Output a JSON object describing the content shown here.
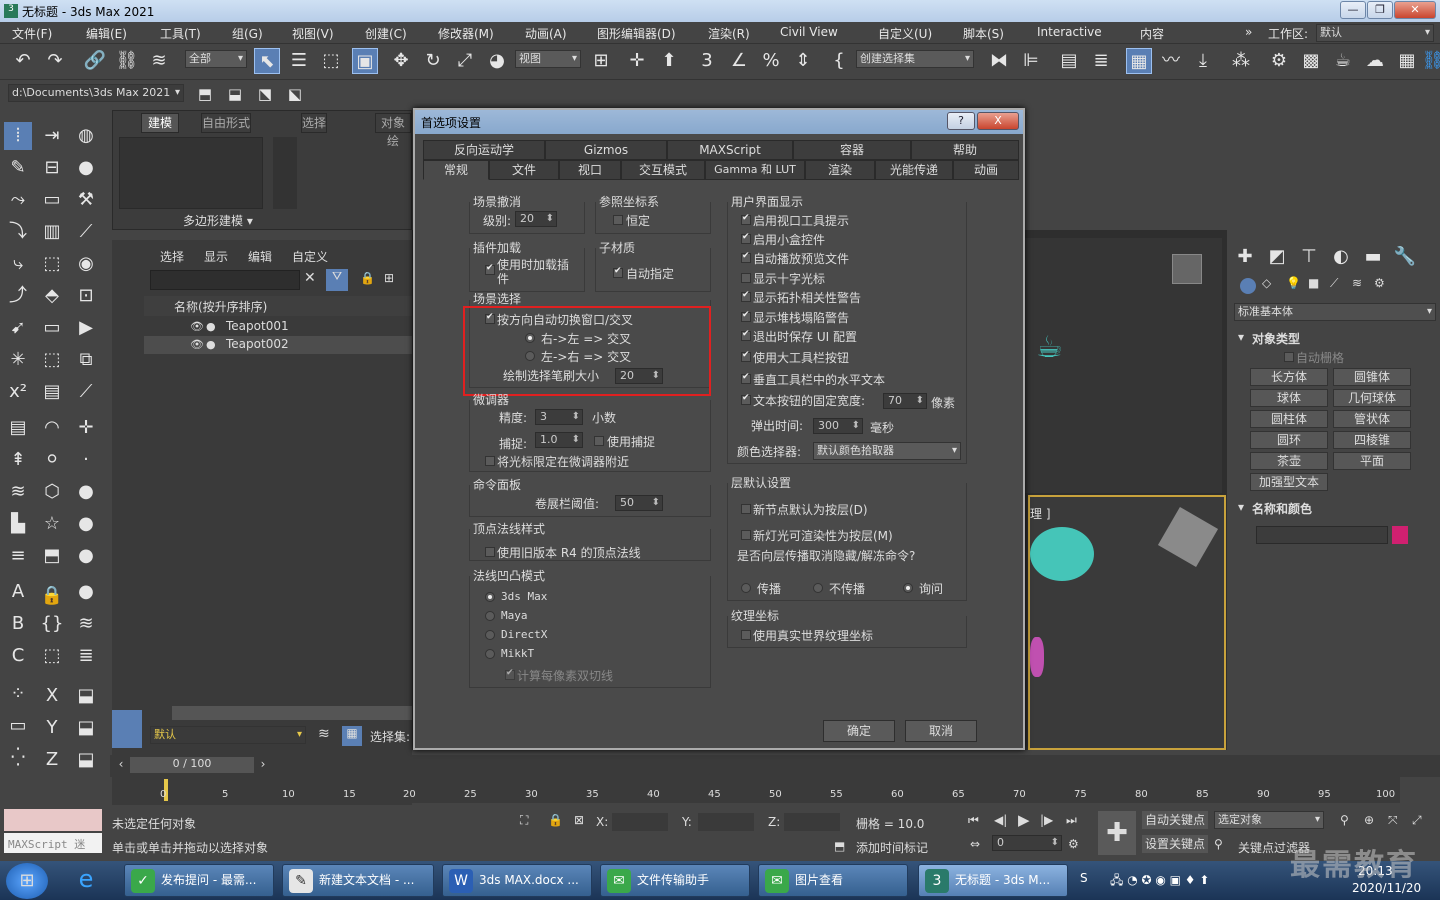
{
  "window": {
    "title": "无标题 - 3ds Max 2021",
    "app_icon": "3"
  },
  "menu": [
    "文件(F)",
    "编辑(E)",
    "工具(T)",
    "组(G)",
    "视图(V)",
    "创建(C)",
    "修改器(M)",
    "动画(A)",
    "图形编辑器(D)",
    "渲染(R)",
    "Civil View",
    "自定义(U)",
    "脚本(S)",
    "Interactive",
    "内容"
  ],
  "workspace": {
    "label": "工作区:",
    "value": "默认"
  },
  "toolbar": {
    "filter": "全部",
    "view": "视图",
    "selection_set": "创建选择集"
  },
  "path": {
    "value": "d:\\Documents\\3ds Max 2021"
  },
  "ribbon": {
    "tabs": [
      "建模",
      "自由形式",
      "选择",
      "对象绘"
    ],
    "group": "多边形建模"
  },
  "explorer": {
    "tabs": [
      "选择",
      "显示",
      "编辑",
      "自定义"
    ],
    "header": "名称(按升序排序)",
    "items": [
      "Teapot001",
      "Teapot002"
    ],
    "layer": "默认",
    "selset": "选择集:"
  },
  "viewport": {
    "label": "理 ]"
  },
  "cmdpanel": {
    "category": "标准基本体",
    "rollout1": "对象类型",
    "autogrid": "自动栅格",
    "buttons": [
      "长方体",
      "圆锥体",
      "球体",
      "几何球体",
      "圆柱体",
      "管状体",
      "圆环",
      "四棱锥",
      "茶壶",
      "平面",
      "加强型文本"
    ],
    "rollout2": "名称和颜色",
    "color": "#d02070"
  },
  "timeline": {
    "frame": "0 / 100",
    "ticks": [
      "0",
      "5",
      "10",
      "15",
      "20",
      "25",
      "30",
      "35",
      "40",
      "45",
      "50",
      "55",
      "60",
      "65",
      "70",
      "75",
      "80",
      "85",
      "90",
      "95",
      "100"
    ]
  },
  "status": {
    "line1": "未选定任何对象",
    "line2": "单击或单击并拖动以选择对象",
    "maxscript": "MAXScript 迷",
    "x": "X:",
    "y": "Y:",
    "z": "Z:",
    "grid": "栅格 = 10.0",
    "add_tag": "添加时间标记",
    "autokey": "自动关键点",
    "selected": "选定对象",
    "setkey": "设置关键点",
    "keyfilter": "关键点过滤器",
    "frame_val": "0"
  },
  "taskbar": {
    "items": [
      "发布提问 - 最需...",
      "新建文本文档 - ...",
      "3ds MAX.docx ...",
      "文件传输助手",
      "图片查看",
      "无标题 - 3ds M..."
    ],
    "time": "20:13",
    "date": "2020/11/20"
  },
  "watermark": "最需教育",
  "dialog": {
    "title": "首选项设置",
    "help": "?",
    "close": "X",
    "tabs_row1": [
      "反向运动学",
      "Gizmos",
      "MAXScript",
      "容器",
      "帮助"
    ],
    "tabs_row2": [
      "常规",
      "文件",
      "视口",
      "交互模式",
      "Gamma 和 LUT",
      "渲染",
      "光能传递",
      "动画"
    ],
    "scene_undo": {
      "title": "场景撤消",
      "level_label": "级别:",
      "level": "20"
    },
    "ref_coord": {
      "title": "参照坐标系",
      "constant": "恒定"
    },
    "plugin": {
      "title": "插件加载",
      "load_on_demand": "使用时加载插件"
    },
    "submat": {
      "title": "子材质",
      "auto_assign": "自动指定"
    },
    "scene_sel": {
      "title": "场景选择",
      "auto_switch": "按方向自动切换窗口/交叉",
      "r2l": "右->左 => 交叉",
      "l2r": "左->右 => 交叉",
      "brush_label": "绘制选择笔刷大小",
      "brush": "20"
    },
    "spinner": {
      "title": "微调器",
      "precision_label": "精度:",
      "precision": "3",
      "decimal": "小数",
      "snap_label": "捕捉:",
      "snap": "1.0",
      "use_snap": "使用捕捉",
      "wrap": "将光标限定在微调器附近"
    },
    "cmdpanel": {
      "title": "命令面板",
      "rollup_label": "卷展栏阈值:",
      "rollup": "50"
    },
    "vertex_normal": {
      "title": "顶点法线样式",
      "legacy": "使用旧版本 R4 的顶点法线"
    },
    "bump": {
      "title": "法线凹凸模式",
      "opts": [
        "3ds Max",
        "Maya",
        "DirectX",
        "MikkT"
      ],
      "compute": "计算每像素双切线"
    },
    "ui_display": {
      "title": "用户界面显示",
      "items": [
        "启用视口工具提示",
        "启用小盒控件",
        "自动播放预览文件",
        "显示十字光标",
        "显示拓扑相关性警告",
        "显示堆栈塌陷警告",
        "退出时保存 UI 配置",
        "使用大工具栏按钮",
        "垂直工具栏中的水平文本",
        "文本按钮的固定宽度:"
      ],
      "btn_width": "70",
      "px": "像素",
      "flyout_label": "弹出时间:",
      "flyout": "300",
      "ms": "毫秒",
      "picker_label": "颜色选择器:",
      "picker": "默认颜色拾取器"
    },
    "layer": {
      "title": "层默认设置",
      "node": "新节点默认为按层(D)",
      "light": "新灯光可渲染性为按层(M)",
      "question": "是否向层传播取消隐藏/解冻命令?",
      "opts": [
        "传播",
        "不传播",
        "询问"
      ]
    },
    "tex": {
      "title": "纹理坐标",
      "real": "使用真实世界纹理坐标"
    },
    "ok": "确定",
    "cancel": "取消"
  }
}
